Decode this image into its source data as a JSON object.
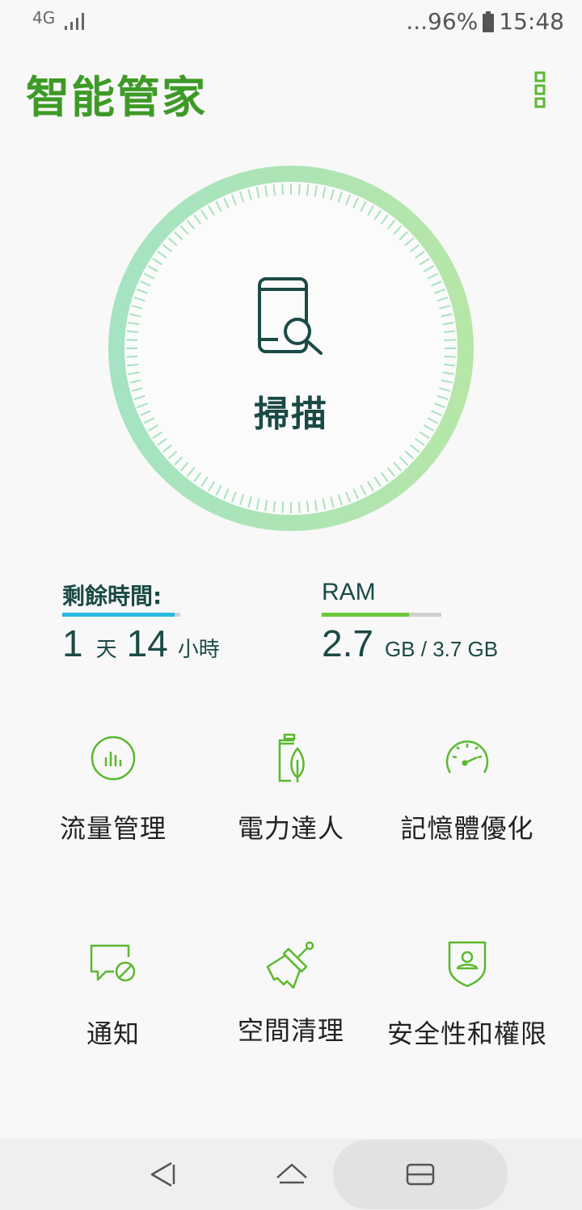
{
  "status_bar": {
    "network": "4G",
    "battery": "...96%",
    "time": "15:48"
  },
  "header": {
    "title": "智能管家",
    "menu_icon": "more-vert-icon"
  },
  "scan": {
    "label": "掃描",
    "icon": "phone-search-icon"
  },
  "battery_stat": {
    "label": "剩餘時間:",
    "days": "1",
    "days_unit": "天",
    "hours": "14",
    "hours_unit": "小時",
    "fill": 0.95,
    "color": "#29b8df"
  },
  "ram_stat": {
    "label": "RAM",
    "used": "2.7",
    "total_text": "GB / 3.7 GB",
    "fill": 0.73,
    "color": "#6cc93b"
  },
  "tiles": [
    {
      "label": "流量管理",
      "icon": "data-usage-icon"
    },
    {
      "label": "電力達人",
      "icon": "battery-leaf-icon"
    },
    {
      "label": "記憶體優化",
      "icon": "speedometer-icon"
    },
    {
      "label": "通知",
      "icon": "notification-block-icon"
    },
    {
      "label": "空間清理",
      "icon": "broom-icon"
    },
    {
      "label": "安全性和權限",
      "icon": "shield-user-icon"
    }
  ],
  "nav": {
    "back_icon": "back-icon",
    "home_icon": "home-icon",
    "recents_icon": "recents-icon"
  },
  "colors": {
    "brand_green": "#3e9a26",
    "icon_green": "#5ab82e",
    "ring_start": "#a5e3c2",
    "ring_end": "#b6e6a8",
    "dark_teal": "#1b4a45"
  }
}
